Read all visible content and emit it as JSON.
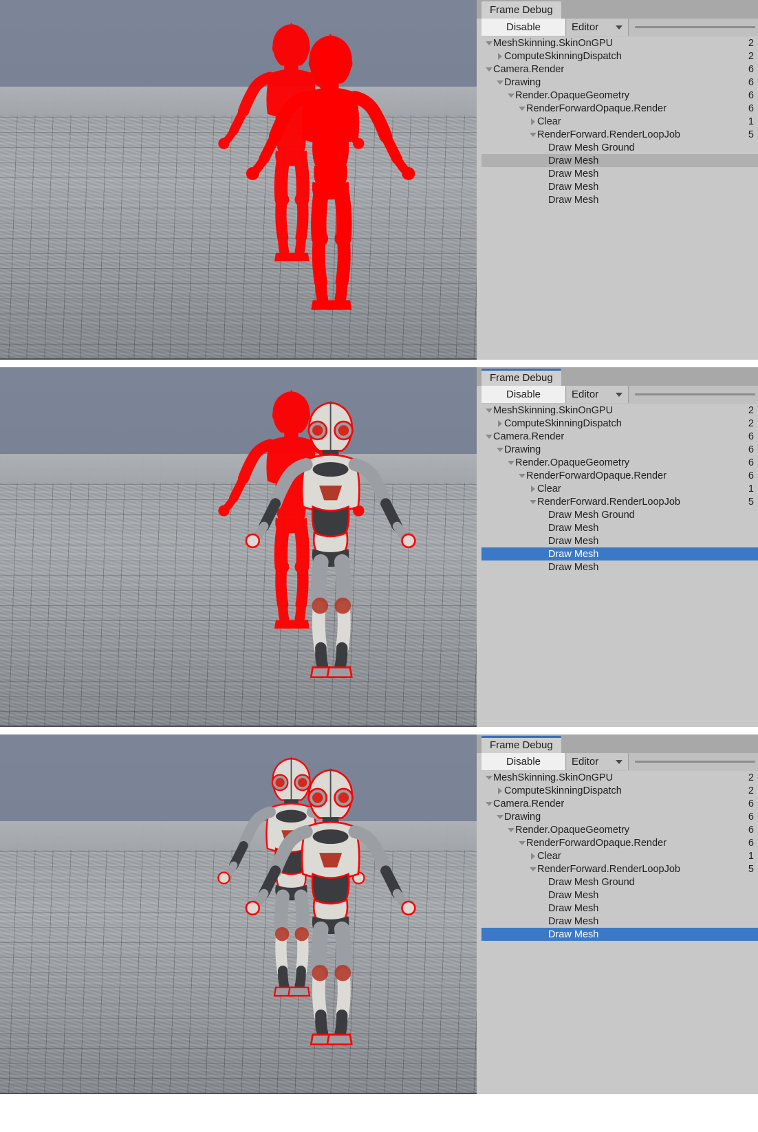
{
  "panels": [
    {
      "id": "panel-1",
      "tab_focused": false,
      "tab_title": "Frame Debug",
      "toolbar": {
        "disable_label": "Disable",
        "dropdown_label": "Editor",
        "dropdown_icon": "chevron-down-icon",
        "slider_icon": "frame-slider"
      },
      "selected_index": 9,
      "selection_style": "gray",
      "rows": [
        {
          "indent": 0,
          "twisty": "down",
          "label": "MeshSkinning.SkinOnGPU",
          "count": "2"
        },
        {
          "indent": 1,
          "twisty": "right",
          "label": "ComputeSkinningDispatch",
          "count": "2"
        },
        {
          "indent": 0,
          "twisty": "down",
          "label": "Camera.Render",
          "count": "6"
        },
        {
          "indent": 1,
          "twisty": "down",
          "label": "Drawing",
          "count": "6"
        },
        {
          "indent": 2,
          "twisty": "down",
          "label": "Render.OpaqueGeometry",
          "count": "6"
        },
        {
          "indent": 3,
          "twisty": "down",
          "label": "RenderForwardOpaque.Render",
          "count": "6"
        },
        {
          "indent": 4,
          "twisty": "right",
          "label": "Clear",
          "count": "1"
        },
        {
          "indent": 4,
          "twisty": "down",
          "label": "RenderForward.RenderLoopJob",
          "count": "5"
        },
        {
          "indent": 5,
          "twisty": "none",
          "label": "Draw Mesh Ground",
          "count": ""
        },
        {
          "indent": 5,
          "twisty": "none",
          "label": "Draw Mesh",
          "count": ""
        },
        {
          "indent": 5,
          "twisty": "none",
          "label": "Draw Mesh",
          "count": ""
        },
        {
          "indent": 5,
          "twisty": "none",
          "label": "Draw Mesh",
          "count": ""
        },
        {
          "indent": 5,
          "twisty": "none",
          "label": "Draw Mesh",
          "count": ""
        }
      ],
      "viewport": {
        "name": "game-view-3d",
        "sky_color": "#7a8296",
        "ground_color": "#a3a7ab",
        "highlight_color": "#ff0000",
        "render_state": "silhouette-only",
        "robots_visible": 0,
        "robots_highlighted": 2
      }
    },
    {
      "id": "panel-2",
      "tab_focused": true,
      "tab_title": "Frame Debug",
      "toolbar": {
        "disable_label": "Disable",
        "dropdown_label": "Editor",
        "dropdown_icon": "chevron-down-icon",
        "slider_icon": "frame-slider"
      },
      "selected_index": 11,
      "selection_style": "blue",
      "rows": [
        {
          "indent": 0,
          "twisty": "down",
          "label": "MeshSkinning.SkinOnGPU",
          "count": "2"
        },
        {
          "indent": 1,
          "twisty": "right",
          "label": "ComputeSkinningDispatch",
          "count": "2"
        },
        {
          "indent": 0,
          "twisty": "down",
          "label": "Camera.Render",
          "count": "6"
        },
        {
          "indent": 1,
          "twisty": "down",
          "label": "Drawing",
          "count": "6"
        },
        {
          "indent": 2,
          "twisty": "down",
          "label": "Render.OpaqueGeometry",
          "count": "6"
        },
        {
          "indent": 3,
          "twisty": "down",
          "label": "RenderForwardOpaque.Render",
          "count": "6"
        },
        {
          "indent": 4,
          "twisty": "right",
          "label": "Clear",
          "count": "1"
        },
        {
          "indent": 4,
          "twisty": "down",
          "label": "RenderForward.RenderLoopJob",
          "count": "5"
        },
        {
          "indent": 5,
          "twisty": "none",
          "label": "Draw Mesh Ground",
          "count": ""
        },
        {
          "indent": 5,
          "twisty": "none",
          "label": "Draw Mesh",
          "count": ""
        },
        {
          "indent": 5,
          "twisty": "none",
          "label": "Draw Mesh",
          "count": ""
        },
        {
          "indent": 5,
          "twisty": "none",
          "label": "Draw Mesh",
          "count": ""
        },
        {
          "indent": 5,
          "twisty": "none",
          "label": "Draw Mesh",
          "count": ""
        }
      ],
      "viewport": {
        "name": "game-view-3d",
        "sky_color": "#7a8296",
        "ground_color": "#a3a7ab",
        "highlight_color": "#ff0000",
        "render_state": "front-robot-drawn",
        "robots_visible": 1,
        "robots_highlighted": 1
      }
    },
    {
      "id": "panel-3",
      "tab_focused": true,
      "tab_title": "Frame Debug",
      "toolbar": {
        "disable_label": "Disable",
        "dropdown_label": "Editor",
        "dropdown_icon": "chevron-down-icon",
        "slider_icon": "frame-slider"
      },
      "selected_index": 12,
      "selection_style": "blue",
      "rows": [
        {
          "indent": 0,
          "twisty": "down",
          "label": "MeshSkinning.SkinOnGPU",
          "count": "2"
        },
        {
          "indent": 1,
          "twisty": "right",
          "label": "ComputeSkinningDispatch",
          "count": "2"
        },
        {
          "indent": 0,
          "twisty": "down",
          "label": "Camera.Render",
          "count": "6"
        },
        {
          "indent": 1,
          "twisty": "down",
          "label": "Drawing",
          "count": "6"
        },
        {
          "indent": 2,
          "twisty": "down",
          "label": "Render.OpaqueGeometry",
          "count": "6"
        },
        {
          "indent": 3,
          "twisty": "down",
          "label": "RenderForwardOpaque.Render",
          "count": "6"
        },
        {
          "indent": 4,
          "twisty": "right",
          "label": "Clear",
          "count": "1"
        },
        {
          "indent": 4,
          "twisty": "down",
          "label": "RenderForward.RenderLoopJob",
          "count": "5"
        },
        {
          "indent": 5,
          "twisty": "none",
          "label": "Draw Mesh Ground",
          "count": ""
        },
        {
          "indent": 5,
          "twisty": "none",
          "label": "Draw Mesh",
          "count": ""
        },
        {
          "indent": 5,
          "twisty": "none",
          "label": "Draw Mesh",
          "count": ""
        },
        {
          "indent": 5,
          "twisty": "none",
          "label": "Draw Mesh",
          "count": ""
        },
        {
          "indent": 5,
          "twisty": "none",
          "label": "Draw Mesh",
          "count": ""
        }
      ],
      "viewport": {
        "name": "game-view-3d",
        "sky_color": "#7a8296",
        "ground_color": "#a3a7ab",
        "highlight_color": "#ff0000",
        "render_state": "both-robots-drawn",
        "robots_visible": 2,
        "robots_highlighted": 2
      }
    }
  ]
}
